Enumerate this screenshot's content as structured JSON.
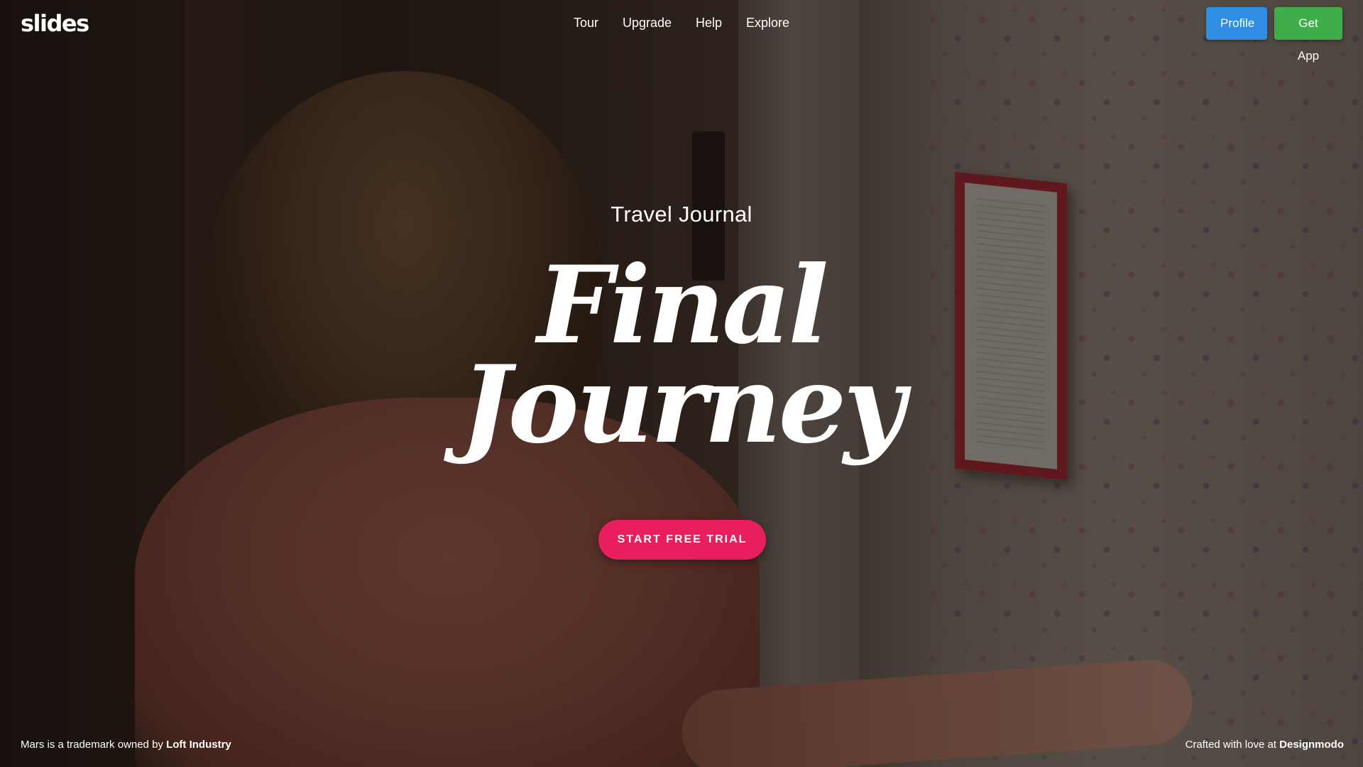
{
  "header": {
    "logo_text": "slides",
    "nav": [
      "Tour",
      "Upgrade",
      "Help",
      "Explore"
    ],
    "profile_label": "Profile",
    "get_app_label": "Get App"
  },
  "hero": {
    "subtitle": "Travel Journal",
    "title_line1": "Final",
    "title_line2": "Journey",
    "cta_label": "START FREE TRIAL"
  },
  "footer": {
    "left_text": "Mars is a trademark owned by",
    "left_link": "Loft Industry",
    "right_text": "Crafted with love at",
    "right_link": "Designmodo"
  },
  "colors": {
    "profile_button": "#2f8de4",
    "get_app_button": "#3fae4a",
    "cta_button": "#e81e5f"
  }
}
